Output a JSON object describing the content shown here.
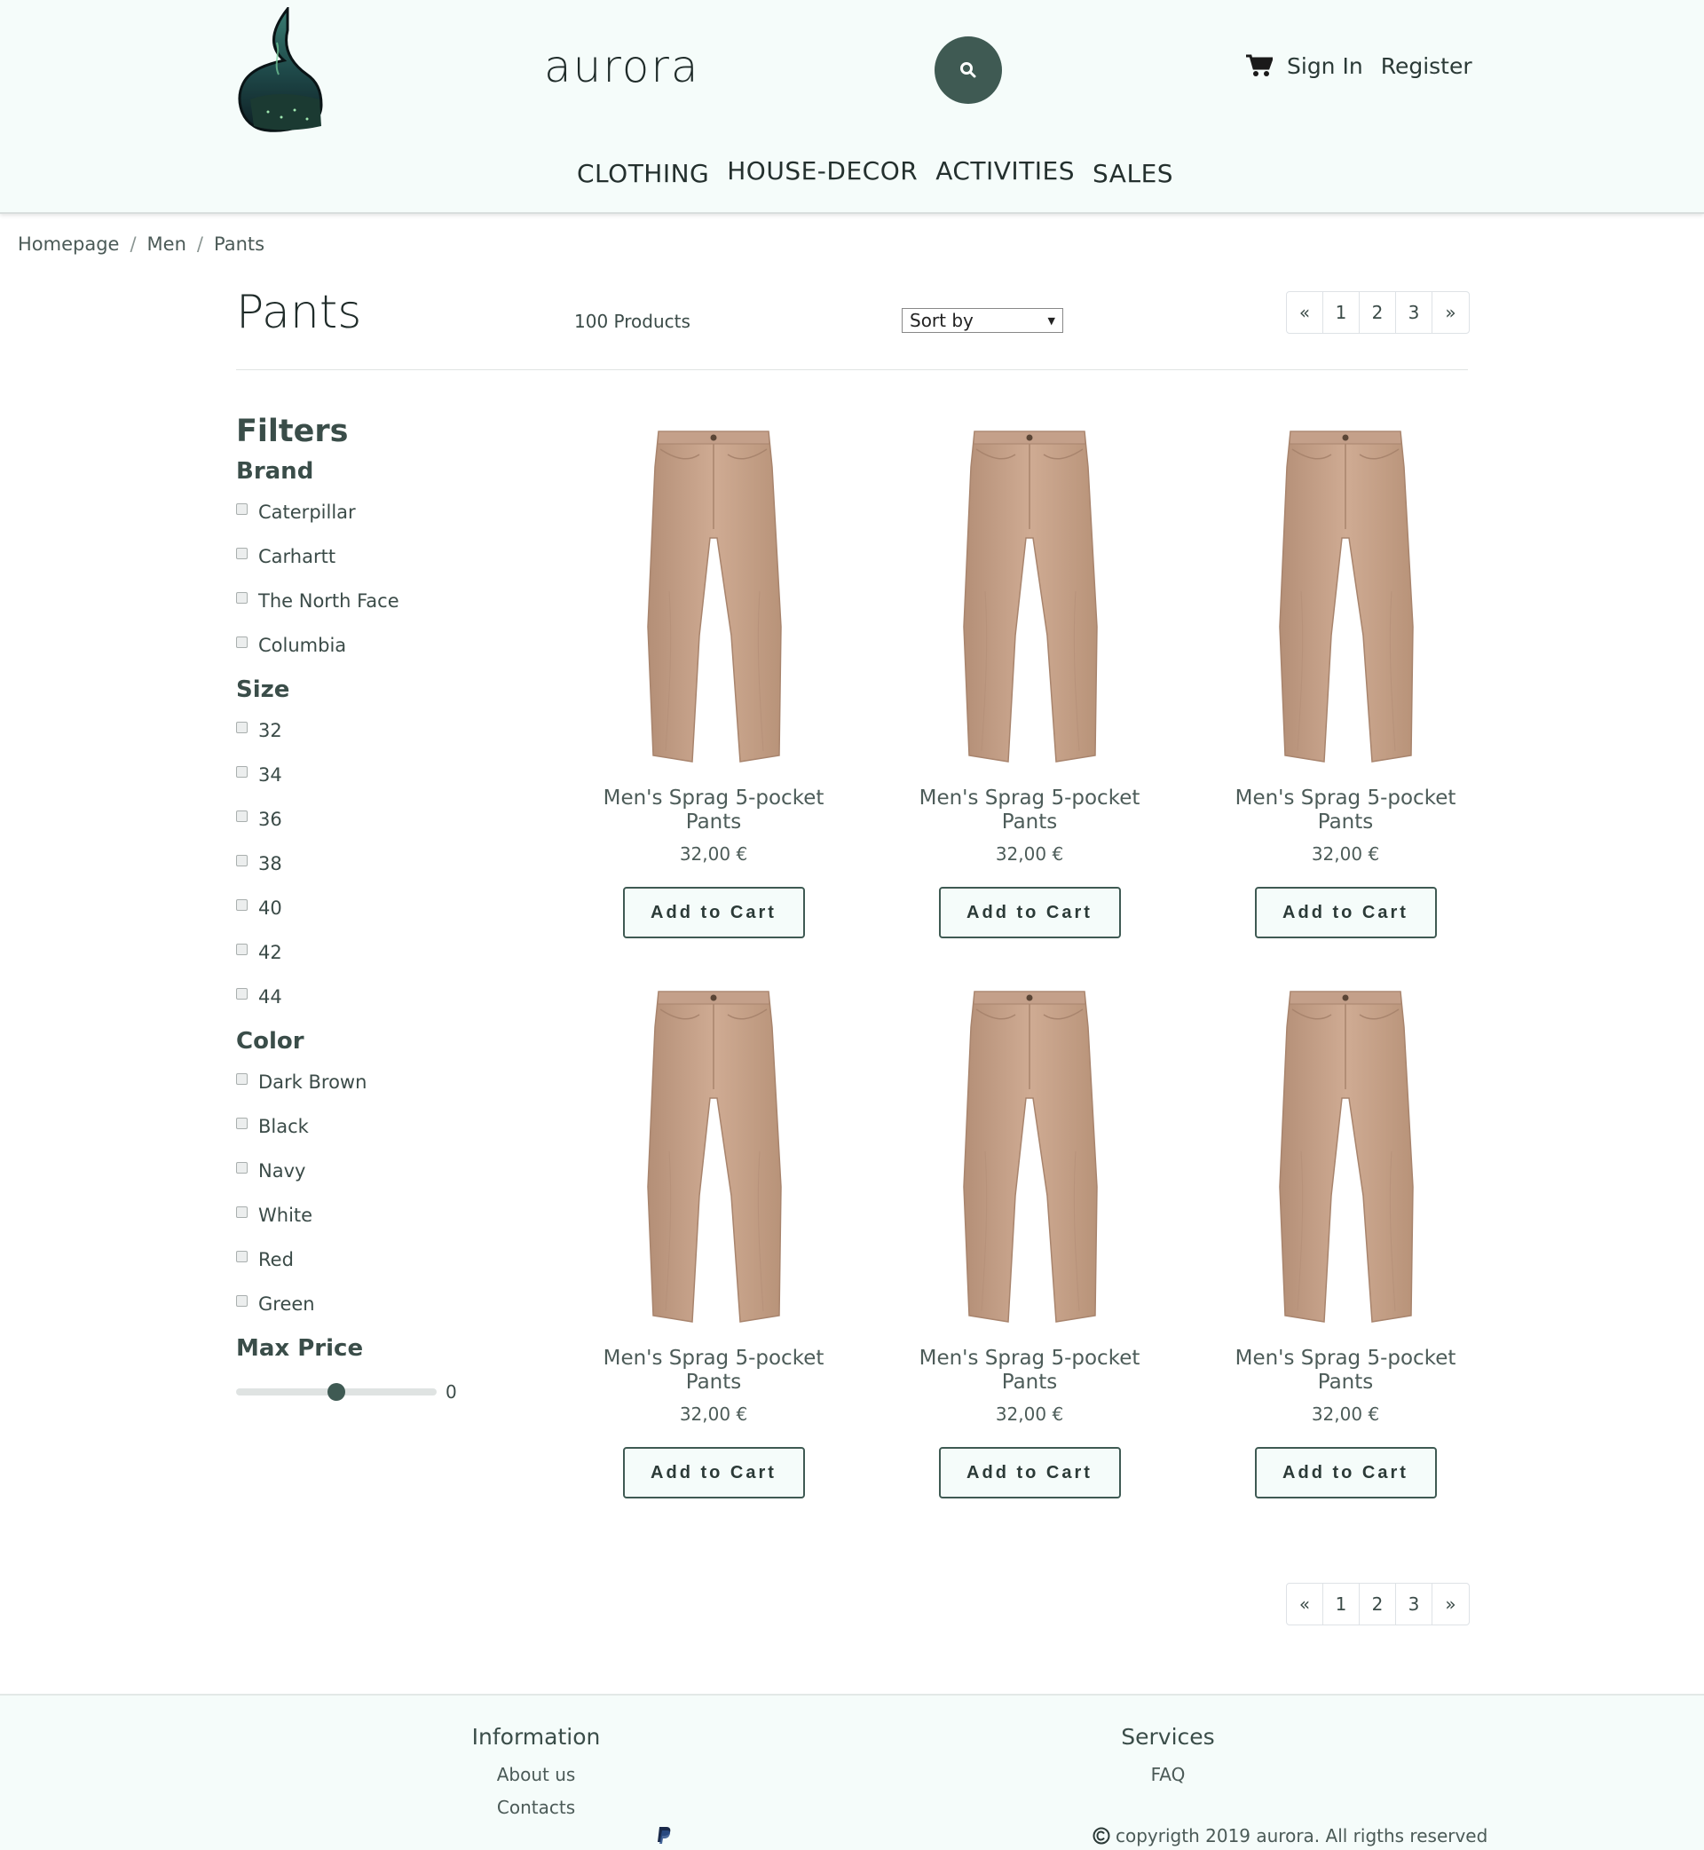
{
  "header": {
    "brand": "aurora",
    "account_links": [
      "Sign In",
      "Register"
    ],
    "nav": [
      "CLOTHING",
      "HOUSE-DECOR",
      "ACTIVITIES",
      "SALES"
    ]
  },
  "breadcrumb": [
    "Homepage",
    "Men",
    "Pants"
  ],
  "listing": {
    "title": "Pants",
    "count": "100 Products",
    "sort_label": "Sort by",
    "pagination": [
      "«",
      "1",
      "2",
      "3",
      "»"
    ]
  },
  "filters": {
    "title": "Filters",
    "brand": {
      "label": "Brand",
      "options": [
        "Caterpillar",
        "Carhartt",
        "The North Face",
        "Columbia"
      ]
    },
    "size": {
      "label": "Size",
      "options": [
        "32",
        "34",
        "36",
        "38",
        "40",
        "42",
        "44"
      ]
    },
    "color": {
      "label": "Color",
      "options": [
        "Dark Brown",
        "Black",
        "Navy",
        "White",
        "Red",
        "Green"
      ]
    },
    "max_price": {
      "label": "Max Price",
      "value": "0",
      "slider_fraction": 0.5
    }
  },
  "products": [
    {
      "name": "Men's Sprag 5-pocket Pants",
      "price": "32,00 €",
      "button": "Add to Cart"
    },
    {
      "name": "Men's Sprag 5-pocket Pants",
      "price": "32,00 €",
      "button": "Add to Cart"
    },
    {
      "name": "Men's Sprag 5-pocket Pants",
      "price": "32,00 €",
      "button": "Add to Cart"
    },
    {
      "name": "Men's Sprag 5-pocket Pants",
      "price": "32,00 €",
      "button": "Add to Cart"
    },
    {
      "name": "Men's Sprag 5-pocket Pants",
      "price": "32,00 €",
      "button": "Add to Cart"
    },
    {
      "name": "Men's Sprag 5-pocket Pants",
      "price": "32,00 €",
      "button": "Add to Cart"
    }
  ],
  "footer": {
    "information": {
      "title": "Information",
      "links": [
        "About us",
        "Contacts"
      ]
    },
    "services": {
      "title": "Services",
      "links": [
        "FAQ"
      ]
    },
    "copyright": "copyrigth 2019 aurora. All rigths reserved"
  },
  "icons": {
    "search": "search-icon",
    "cart": "cart-icon",
    "payment": "paypal-icon",
    "copyright": "copyright-icon"
  },
  "colors": {
    "accent": "#3f5a53",
    "header_bg": "#f5fcfa",
    "product_tan": "#c9a48b"
  }
}
